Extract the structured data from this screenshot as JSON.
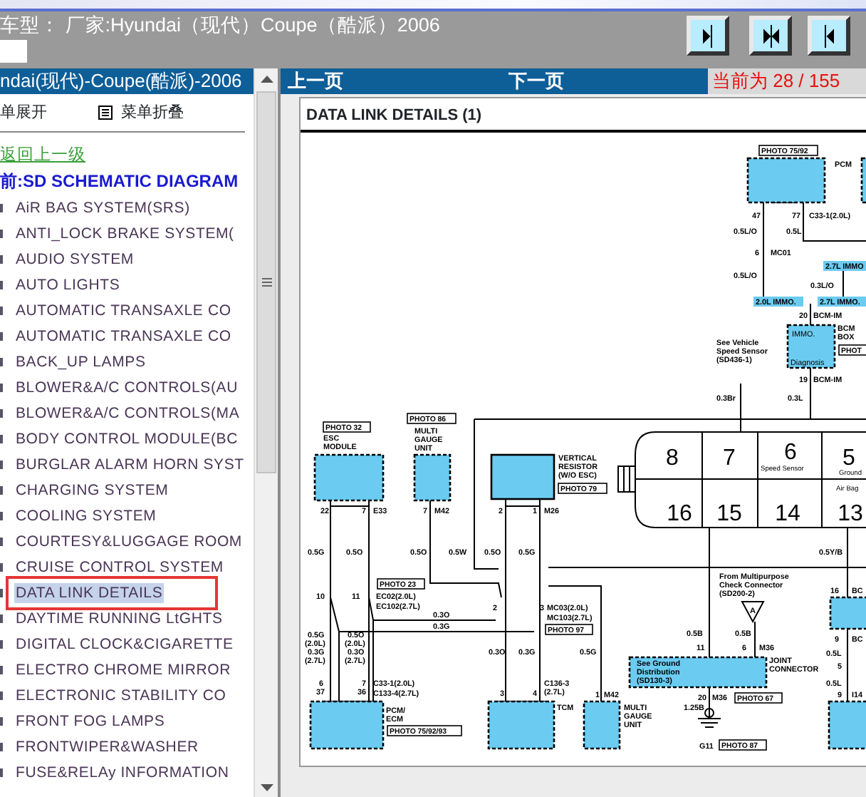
{
  "window": {
    "title": "车型： 厂家:Hyundai（现代）Coupe（酷派）2006"
  },
  "sidebar": {
    "header": "ndai(现代)-Coupe(酷派)-2006",
    "expand": "单展开",
    "collapse": "菜单折叠",
    "back_link": "返回上一级",
    "current": "前:SD SCHEMATIC DIAGRAM",
    "items": [
      {
        "label": "AiR BAG SYSTEM(SRS)",
        "selected": false
      },
      {
        "label": "ANTI_LOCK BRAKE SYSTEM(",
        "selected": false
      },
      {
        "label": "AUDIO SYSTEM",
        "selected": false
      },
      {
        "label": "AUTO LIGHTS",
        "selected": false
      },
      {
        "label": "AUTOMATIC TRANSAXLE CO",
        "selected": false
      },
      {
        "label": "AUTOMATIC TRANSAXLE CO",
        "selected": false
      },
      {
        "label": "BACK_UP LAMPS",
        "selected": false
      },
      {
        "label": "BLOWER&A/C CONTROLS(AU",
        "selected": false
      },
      {
        "label": "BLOWER&A/C CONTROLS(MA",
        "selected": false
      },
      {
        "label": "BODY CONTROL MODULE(BC",
        "selected": false
      },
      {
        "label": "BURGLAR ALARM HORN SYST",
        "selected": false
      },
      {
        "label": "CHARGING SYSTEM",
        "selected": false
      },
      {
        "label": "COOLING SYSTEM",
        "selected": false
      },
      {
        "label": "COURTESY&LUGGAGE ROOM",
        "selected": false
      },
      {
        "label": "CRUISE CONTROL SYSTEM",
        "selected": false
      },
      {
        "label": "DATA LINK DETAILS",
        "selected": true
      },
      {
        "label": "DAYTIME RUNNING LtGHTS",
        "selected": false
      },
      {
        "label": "DIGITAL CLOCK&CIGARETTE",
        "selected": false
      },
      {
        "label": "ELECTRO CHROME MIRROR",
        "selected": false
      },
      {
        "label": "ELECTRONIC STABILITY CO",
        "selected": false
      },
      {
        "label": "FRONT FOG LAMPS",
        "selected": false
      },
      {
        "label": "FRONTWIPER&WASHER",
        "selected": false
      },
      {
        "label": "FUSE&RELAy INFORMATION",
        "selected": false
      }
    ]
  },
  "pager": {
    "prev": "上一页",
    "next": "下一页",
    "counter": "当前为 28 / 155"
  },
  "document": {
    "title": "DATA LINK DETAILS (1)",
    "diagram": {
      "photo_tags": [
        "PHOTO 75/92",
        "PHOT",
        "PHOTO 32",
        "PHOTO 86",
        "PHOTO 79",
        "PHOTO 23",
        "PHOTO 97",
        "PHOTO 67",
        "PHOTO 75/92/93",
        "PHOTO 87"
      ],
      "immo_tags": [
        "2.7L IMMO",
        "2.0L IMMO.",
        "2.7L IMMO."
      ],
      "module_texts": [
        "IMMO.",
        "Diagnosis"
      ],
      "triangle": "A",
      "pins": [
        "8",
        "7",
        "6",
        "5",
        "16",
        "15",
        "14",
        "13"
      ],
      "pin_notes": [
        "Speed Sensor",
        "Ground",
        "Air Bag"
      ],
      "labels": [
        "PCM",
        "47",
        "77",
        "C33-1(2.0L)",
        "0.5L/O",
        "0.5L",
        "6",
        "MC01",
        "0.5L/O",
        "0.3L/O",
        "20",
        "BCM-IM",
        "BCM",
        "BOX",
        "See Vehicle",
        "Speed Sensor",
        "(SD436-1)",
        "19",
        "BCM-IM",
        "0.3Br",
        "0.3L",
        "ESC",
        "MODULE",
        "MULTI",
        "GAUGE",
        "UNIT",
        "VERTICAL",
        "RESISTOR",
        "(W/O ESC)",
        "22",
        "7",
        "E33",
        "7",
        "M42",
        "2",
        "1",
        "M26",
        "0.5G",
        "0.5O",
        "0.5O",
        "0.5W",
        "0.5O",
        "0.5G",
        "0.5Y/B",
        "10",
        "11",
        "EC02(2.0L)",
        "EC102(2.7L)",
        "2",
        "3",
        "MC03(2.0L)",
        "MC103(2.7L)",
        "0.3O",
        "0.3G",
        "From Multipurpose",
        "Check Connector",
        "(SD200-2)",
        "16",
        "BC",
        "0.5B",
        "0.5B",
        "11",
        "6",
        "M36",
        "9",
        "BC",
        "0.5L",
        "0.5G",
        "(2.0L)",
        "0.3G",
        "(2.7L)",
        "0.5O",
        "(2.0L)",
        "0.3O",
        "(2.7L)",
        "0.3O",
        "0.3G",
        "0.5G",
        "6",
        "37",
        "7",
        "36",
        "C33-1(2.0L)",
        "C133-4(2.7L)",
        "C136-3",
        "3",
        "4",
        "(2.7L)",
        "1",
        "M42",
        "JOINT",
        "CONNECTOR",
        "See Ground",
        "Distribution",
        "(SD130-3)",
        "20",
        "M36",
        "1.25B",
        "PCM/",
        "ECM",
        "TCM",
        "MULTI",
        "GAUGE",
        "UNIT",
        "G11",
        "5",
        "0.5L",
        "9",
        "I14"
      ]
    }
  }
}
